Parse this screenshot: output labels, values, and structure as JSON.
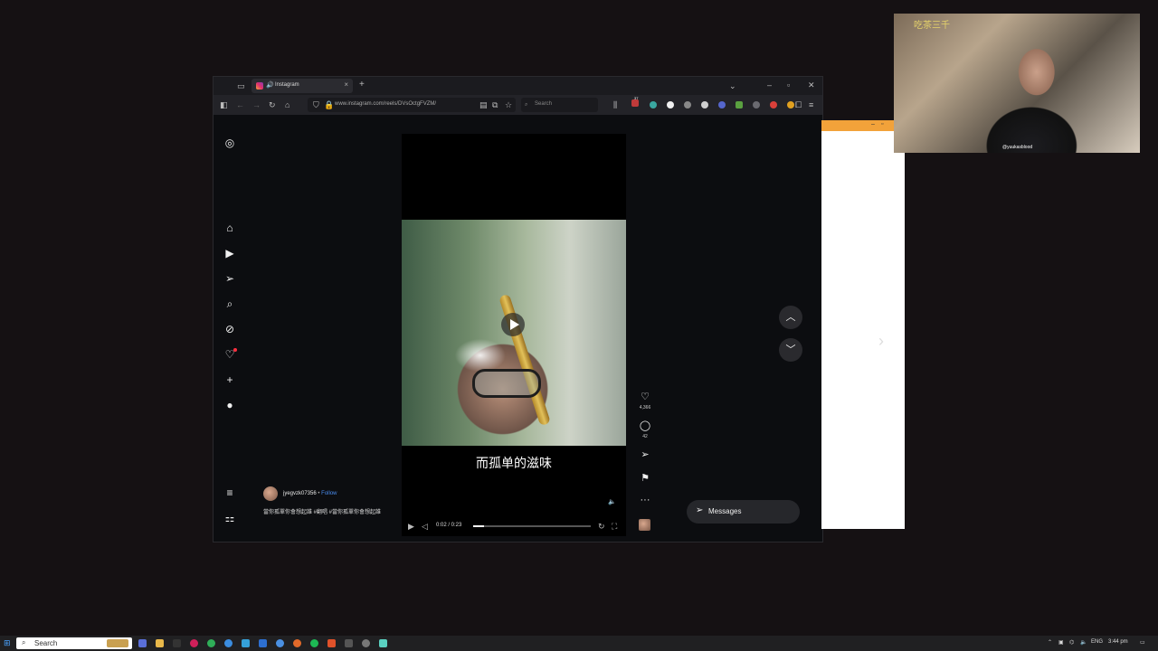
{
  "browser": {
    "tab_title": "Instagram",
    "url": "www.instagram.com/reels/DVsOctgFVZM/",
    "search_placeholder": "Search",
    "ext_badge": "37"
  },
  "reel": {
    "subtitle": "而孤单的滋味",
    "time": "0:02 / 0:23",
    "progress_fraction": 0.09,
    "author": "jyegvzk07356",
    "separator": "•",
    "follow_label": "Follow",
    "caption": "當你孤單你會想起誰 #翻唱 #當你孤單你會想起誰",
    "likes": "4,366",
    "comments": "42"
  },
  "messages_label": "Messages",
  "cam": {
    "logo_text": "吃茶三千",
    "handle": "@yuukasblood"
  },
  "taskbar": {
    "search_label": "Search",
    "lang": "ENG",
    "time": "3:44 pm"
  },
  "colors": {
    "follow": "#4a8df0",
    "accent_orange": "#f2a23a"
  }
}
